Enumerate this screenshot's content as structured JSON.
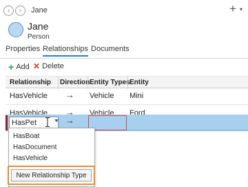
{
  "header": {
    "title": "Jane",
    "back_icon": "‹",
    "forward_icon": "›",
    "add_icon": "+"
  },
  "entity": {
    "name": "Jane",
    "type": "Person",
    "avatar_color": "#bcd7f2"
  },
  "tabs": [
    {
      "label": "Properties",
      "active": false
    },
    {
      "label": "Relationships",
      "active": true
    },
    {
      "label": "Documents",
      "active": false
    }
  ],
  "toolbar": {
    "add_label": "Add",
    "delete_label": "Delete"
  },
  "grid": {
    "columns": [
      "Relationship",
      "Direction",
      "Entity Types",
      "Entity"
    ],
    "rows": [
      {
        "relationship": "HasVehicle",
        "direction": "→",
        "entity_type": "Vehicle",
        "entity": "Mini"
      },
      {
        "relationship": "HasVehicle",
        "direction": "→",
        "entity_type": "Vehicle",
        "entity": "Ford"
      }
    ],
    "editing_row": {
      "relationship": "HasPet",
      "direction": "→",
      "entity_type": "",
      "entity": ""
    }
  },
  "dropdown": {
    "options": [
      "HasBoat",
      "HasDocument",
      "HasVehicle"
    ],
    "new_type_label": "New Relationship Type"
  },
  "colors": {
    "accent": "#2b7cd3",
    "selected_row": "#a7cfee",
    "error_border": "#d9434f",
    "highlight_border": "#e98a2e"
  }
}
